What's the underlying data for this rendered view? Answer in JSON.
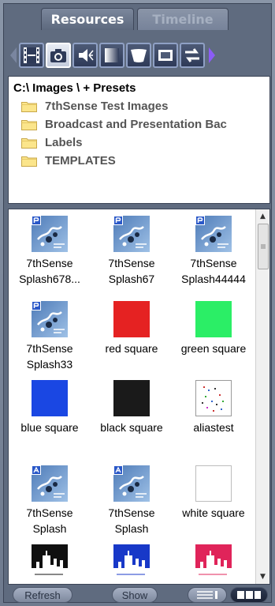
{
  "tabs": [
    {
      "label": "Resources",
      "active": true
    },
    {
      "label": "Timeline",
      "active": false
    }
  ],
  "toolbar": {
    "buttons": [
      {
        "icon": "film-icon",
        "active": false
      },
      {
        "icon": "camera-icon",
        "active": true
      },
      {
        "icon": "speaker-icon",
        "active": false
      },
      {
        "icon": "gradient-icon",
        "active": false
      },
      {
        "icon": "mask-icon",
        "active": false
      },
      {
        "icon": "screen-icon",
        "active": false
      },
      {
        "icon": "swap-icon",
        "active": false
      }
    ]
  },
  "tree": {
    "path": "C:\\ Images \\  + Presets",
    "folders": [
      "7thSense Test Images",
      "Broadcast and Presentation Bac",
      "Labels",
      "TEMPLATES"
    ]
  },
  "thumbnails": [
    {
      "label": "7thSense Splash678...",
      "kind": "splash-p"
    },
    {
      "label": "7thSense Splash67",
      "kind": "splash-p"
    },
    {
      "label": "7thSense Splash44444",
      "kind": "splash-p"
    },
    {
      "label": "7thSense Splash33",
      "kind": "splash-p"
    },
    {
      "label": "red square",
      "kind": "color",
      "color": "#e52222"
    },
    {
      "label": "green square",
      "kind": "color",
      "color": "#2bee66"
    },
    {
      "label": "blue square",
      "kind": "color",
      "color": "#1a47e3"
    },
    {
      "label": "black square",
      "kind": "color",
      "color": "#1a1a1a"
    },
    {
      "label": "aliastest",
      "kind": "alias"
    },
    {
      "label": "7thSense Splash",
      "kind": "splash-a"
    },
    {
      "label": "7thSense Splash",
      "kind": "splash-a"
    },
    {
      "label": "white square",
      "kind": "color",
      "color": "#ffffff"
    },
    {
      "label": "",
      "kind": "city",
      "color": "#101010"
    },
    {
      "label": "",
      "kind": "city",
      "color": "#1838c8"
    },
    {
      "label": "",
      "kind": "city",
      "color": "#e0245a"
    }
  ],
  "bottombar": {
    "refresh_label": "Refresh",
    "show_label": "Show"
  }
}
